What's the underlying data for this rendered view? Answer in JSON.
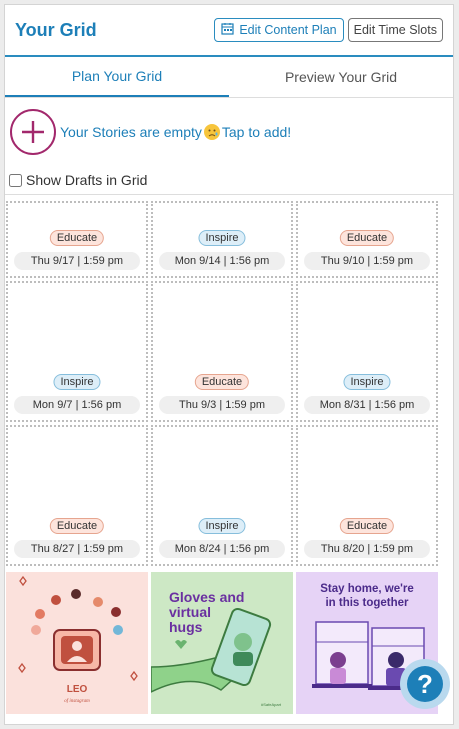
{
  "header": {
    "title": "Your Grid",
    "edit_content_plan": "Edit Content Plan",
    "edit_time_slots": "Edit Time Slots"
  },
  "tabs": [
    {
      "label": "Plan Your Grid",
      "active": true
    },
    {
      "label": "Preview Your Grid",
      "active": false
    }
  ],
  "stories": {
    "text_before": "Your Stories are empty",
    "text_after": "Tap to add!"
  },
  "drafts": {
    "label": "Show Drafts in Grid",
    "checked": false
  },
  "grid": [
    {
      "tag": "Educate",
      "date": "Thu 9/17 | 1:59 pm"
    },
    {
      "tag": "Inspire",
      "date": "Mon 9/14 | 1:56 pm"
    },
    {
      "tag": "Educate",
      "date": "Thu 9/10 | 1:59 pm"
    },
    {
      "tag": "Inspire",
      "date": "Mon 9/7 | 1:56 pm"
    },
    {
      "tag": "Educate",
      "date": "Thu 9/3 | 1:59 pm"
    },
    {
      "tag": "Inspire",
      "date": "Mon 8/31 | 1:56 pm"
    },
    {
      "tag": "Educate",
      "date": "Thu 8/27 | 1:59 pm"
    },
    {
      "tag": "Inspire",
      "date": "Mon 8/24 | 1:56 pm"
    },
    {
      "tag": "Educate",
      "date": "Thu 8/20 | 1:59 pm"
    }
  ],
  "images": [
    {
      "title": "LEO",
      "subtitle": "of instagram"
    },
    {
      "title": "Gloves and virtual hugs",
      "title_lines": [
        "Gloves and",
        "virtual",
        "hugs"
      ],
      "footer": "#SafeApart"
    },
    {
      "title": "Stay home, we're in this together",
      "title_lines": [
        "Stay home, we're",
        "in this together"
      ]
    }
  ],
  "help": {
    "label": "?"
  },
  "colors": {
    "accent": "#1d7fb8",
    "brand_plus": "#a2286c",
    "educate_bg": "#fde4dc",
    "inspire_bg": "#ddeef8"
  }
}
